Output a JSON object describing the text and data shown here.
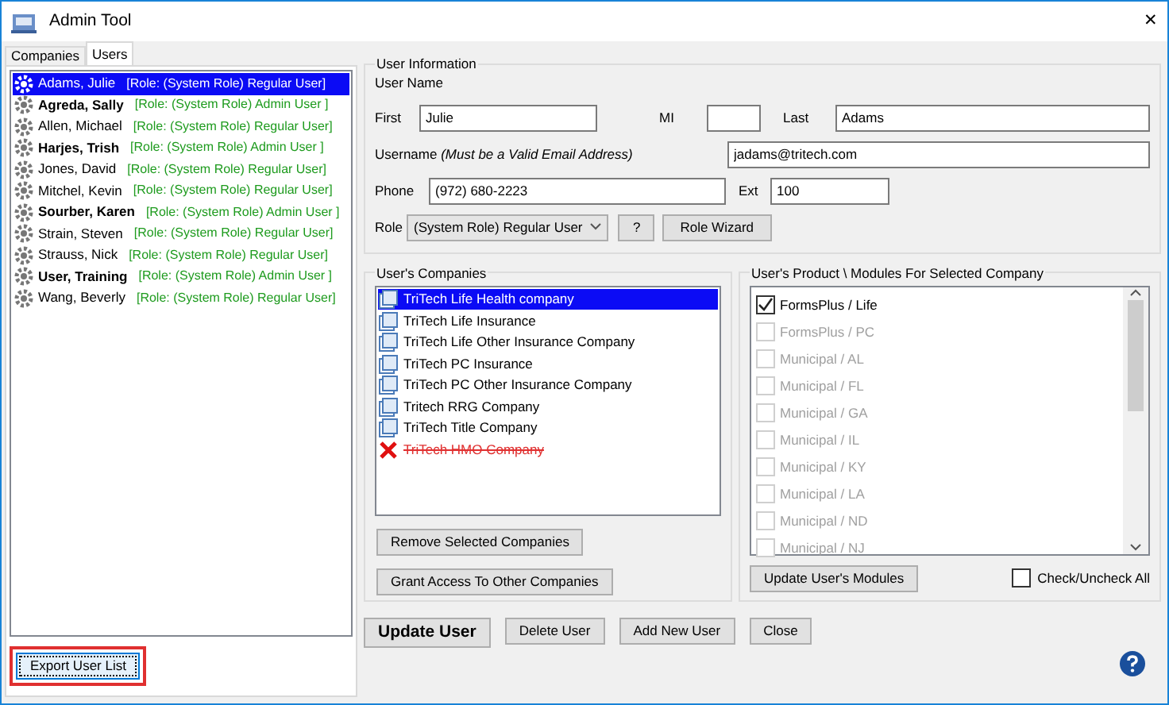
{
  "window": {
    "title": "Admin Tool",
    "close_glyph": "✕"
  },
  "tabs": [
    {
      "label": "Companies",
      "selected": false
    },
    {
      "label": "Users",
      "selected": true
    }
  ],
  "users": [
    {
      "name": "Adams, Julie",
      "role": "[Role: (System Role) Regular User]",
      "bold": false,
      "selected": true
    },
    {
      "name": "Agreda, Sally",
      "role": "[Role: (System Role) Admin User ]",
      "bold": true,
      "selected": false
    },
    {
      "name": "Allen, Michael",
      "role": "[Role: (System Role) Regular User]",
      "bold": false,
      "selected": false
    },
    {
      "name": "Harjes, Trish",
      "role": "[Role: (System Role) Admin User ]",
      "bold": true,
      "selected": false
    },
    {
      "name": "Jones, David",
      "role": "[Role: (System Role) Regular User]",
      "bold": false,
      "selected": false
    },
    {
      "name": "Mitchel, Kevin",
      "role": "[Role: (System Role) Regular User]",
      "bold": false,
      "selected": false
    },
    {
      "name": "Sourber, Karen",
      "role": "[Role: (System Role) Admin User ]",
      "bold": true,
      "selected": false
    },
    {
      "name": "Strain, Steven",
      "role": "[Role: (System Role) Regular User]",
      "bold": false,
      "selected": false
    },
    {
      "name": "Strauss, Nick",
      "role": "[Role: (System Role) Regular User]",
      "bold": false,
      "selected": false
    },
    {
      "name": "User, Training",
      "role": "[Role: (System Role) Admin User ]",
      "bold": true,
      "selected": false
    },
    {
      "name": "Wang, Beverly",
      "role": "[Role: (System Role) Regular User]",
      "bold": false,
      "selected": false
    }
  ],
  "export_button": {
    "label": "Export User List",
    "highlighted": true
  },
  "user_information": {
    "title": "User Information",
    "user_name_label": "User Name",
    "first_label": "First",
    "first": "Julie",
    "mi_label": "MI",
    "last_label": "Last",
    "last": "Adams",
    "username_label": "Username",
    "username_hint": "(Must be a Valid Email Address)",
    "username": "jadams@tritech.com",
    "phone_label": "Phone",
    "phone": "(972) 680-2223",
    "ext_label": "Ext",
    "ext": "100",
    "role_label": "Role",
    "role": "(System Role) Regular User",
    "help_button": "?",
    "wizard_button": "Role Wizard"
  },
  "companies": {
    "title": "User's Companies",
    "items": [
      {
        "name": "TriTech Life Health company",
        "kind": "company",
        "selected": true
      },
      {
        "name": "TriTech Life Insurance",
        "kind": "company",
        "selected": false
      },
      {
        "name": "TriTech Life Other Insurance Company",
        "kind": "company",
        "selected": false
      },
      {
        "name": "TriTech PC Insurance",
        "kind": "company",
        "selected": false
      },
      {
        "name": "TriTech PC Other Insurance Company",
        "kind": "company",
        "selected": false
      },
      {
        "name": "Tritech RRG Company",
        "kind": "company",
        "selected": false
      },
      {
        "name": "TriTech Title Company",
        "kind": "company",
        "selected": false
      },
      {
        "name": "TriTech HMO Company",
        "kind": "removed",
        "selected": false
      }
    ],
    "buttons": [
      "Remove Selected Companies",
      "Grant Access To Other Companies"
    ]
  },
  "modules": {
    "title": "User's Product \\ Modules For Selected Company",
    "items": [
      {
        "label": "FormsPlus / Life",
        "checked": true,
        "disabled": false
      },
      {
        "label": "FormsPlus / PC",
        "checked": false,
        "disabled": true
      },
      {
        "label": "Municipal / AL",
        "checked": false,
        "disabled": true
      },
      {
        "label": "Municipal / FL",
        "checked": false,
        "disabled": true
      },
      {
        "label": "Municipal / GA",
        "checked": false,
        "disabled": true
      },
      {
        "label": "Municipal / IL",
        "checked": false,
        "disabled": true
      },
      {
        "label": "Municipal / KY",
        "checked": false,
        "disabled": true
      },
      {
        "label": "Municipal / LA",
        "checked": false,
        "disabled": true
      },
      {
        "label": "Municipal / ND",
        "checked": false,
        "disabled": true
      },
      {
        "label": "Municipal / NJ",
        "checked": false,
        "disabled": true
      }
    ],
    "update_button": "Update User's Modules",
    "check_all": {
      "label": "Check/Uncheck All",
      "checked": false
    }
  },
  "actions": [
    {
      "label": "Update User",
      "kind": "primary"
    },
    {
      "label": "Delete User",
      "kind": "normal"
    },
    {
      "label": "Add New User",
      "kind": "normal"
    },
    {
      "label": "Close",
      "kind": "normal"
    }
  ]
}
